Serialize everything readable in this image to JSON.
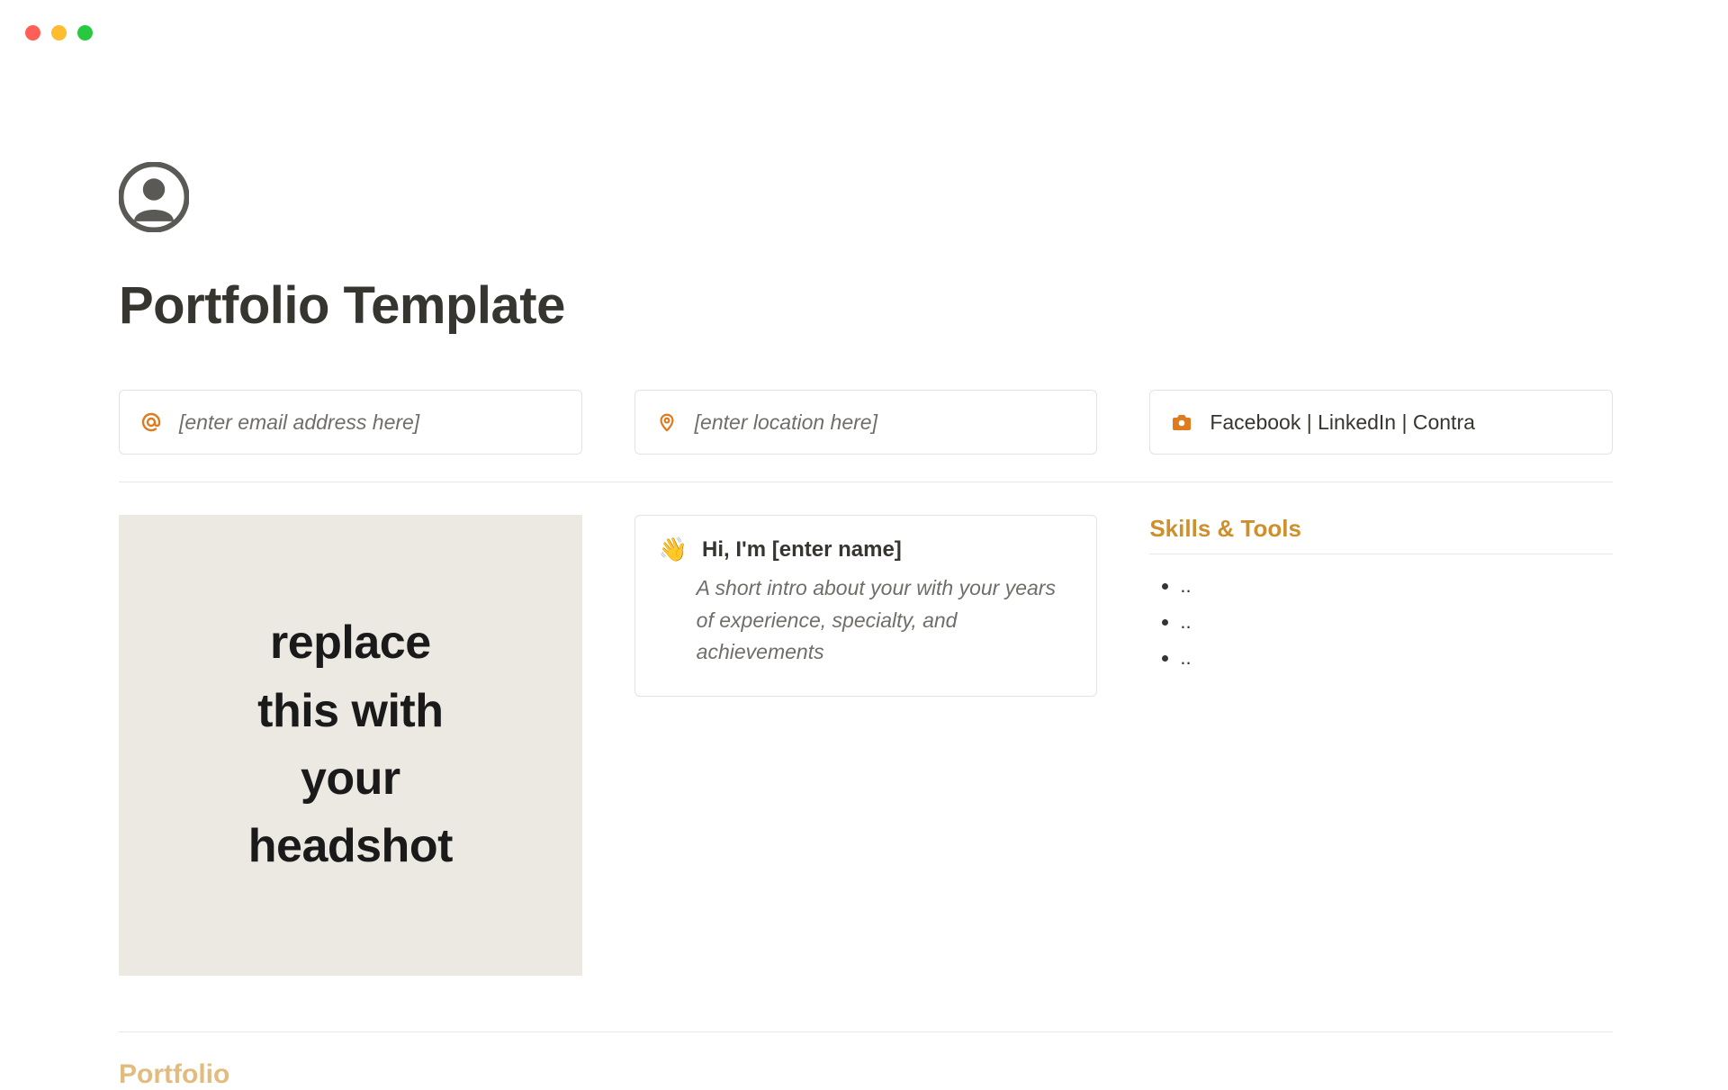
{
  "title": "Portfolio Template",
  "contact": {
    "email_placeholder": "[enter email address here]",
    "location_placeholder": "[enter location here]",
    "social": {
      "facebook": "Facebook",
      "linkedin": "LinkedIn",
      "contra": "Contra"
    }
  },
  "headshot_placeholder": "replace this with your headshot",
  "intro": {
    "heading": "Hi, I'm [enter name]",
    "body": "A short intro about your with your years of experience, specialty, and achievements"
  },
  "skills": {
    "title": "Skills & Tools",
    "items": [
      "..",
      "..",
      ".."
    ]
  },
  "sections": {
    "portfolio_heading": "Portfolio"
  },
  "colors": {
    "accent": "#cf8f2a",
    "icon_orange": "#e07a1f",
    "text": "#37352f",
    "muted": "#6f6e69",
    "border": "#e4e3e1",
    "headshot_bg": "#ece9e2"
  }
}
